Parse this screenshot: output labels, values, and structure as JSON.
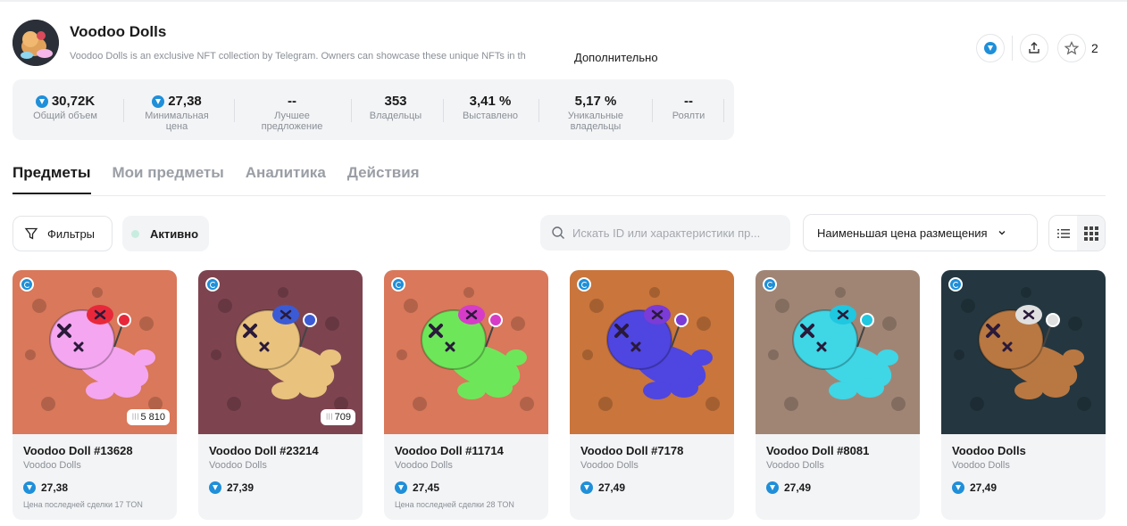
{
  "collection": {
    "title": "Voodoo Dolls",
    "description": "Voodoo Dolls is an exclusive NFT collection by Telegram. Owners can showcase these unique NFTs in th",
    "more_label": "Дополнительно",
    "favorites_count": "2"
  },
  "stats": [
    {
      "value": "30,72K",
      "label": "Общий объем",
      "ton": true
    },
    {
      "value": "27,38",
      "label": "Минимальная цена",
      "ton": true
    },
    {
      "value": "--",
      "label": "Лучшее предложение",
      "ton": false
    },
    {
      "value": "353",
      "label": "Владельцы",
      "ton": false
    },
    {
      "value": "3,41 %",
      "label": "Выставлено",
      "ton": false
    },
    {
      "value": "5,17 %",
      "label": "Уникальные владельцы",
      "ton": false
    },
    {
      "value": "--",
      "label": "Роялти",
      "ton": false
    }
  ],
  "tabs": [
    {
      "label": "Предметы",
      "active": true
    },
    {
      "label": "Мои предметы",
      "active": false
    },
    {
      "label": "Аналитика",
      "active": false
    },
    {
      "label": "Действия",
      "active": false
    }
  ],
  "toolbar": {
    "filters_label": "Фильтры",
    "status_label": "Активно",
    "search_placeholder": "Искать ID или характеристики пр...",
    "sort_label": "Наименьшая цена размещения"
  },
  "cards": [
    {
      "name": "Voodoo Doll #13628",
      "collection": "Voodoo Dolls",
      "price": "27,38",
      "views": "5 810",
      "last_sale": "Цена последней сделки 17 TON",
      "bg": "#d9785a",
      "doll": "#f5a6f0",
      "pin": "#e8283a"
    },
    {
      "name": "Voodoo Doll #23214",
      "collection": "Voodoo Dolls",
      "price": "27,39",
      "views": "709",
      "last_sale": "",
      "bg": "#7d4450",
      "doll": "#e9c27e",
      "pin": "#3b5bd6"
    },
    {
      "name": "Voodoo Doll #11714",
      "collection": "Voodoo Dolls",
      "price": "27,45",
      "views": "",
      "last_sale": "Цена последней сделки 28 TON",
      "bg": "#d9785a",
      "doll": "#6ee65a",
      "pin": "#d63cc8"
    },
    {
      "name": "Voodoo Doll #7178",
      "collection": "Voodoo Dolls",
      "price": "27,49",
      "views": "",
      "last_sale": "",
      "bg": "#c9753c",
      "doll": "#4f45e0",
      "pin": "#7a3bd6"
    },
    {
      "name": "Voodoo Doll #8081",
      "collection": "Voodoo Dolls",
      "price": "27,49",
      "views": "",
      "last_sale": "",
      "bg": "#a08575",
      "doll": "#3fd6e6",
      "pin": "#1fc7e0"
    },
    {
      "name": "Voodoo Dolls",
      "collection": "Voodoo Dolls",
      "price": "27,49",
      "views": "",
      "last_sale": "",
      "bg": "#243740",
      "doll": "#b97842",
      "pin": "#e0e0e0"
    }
  ]
}
